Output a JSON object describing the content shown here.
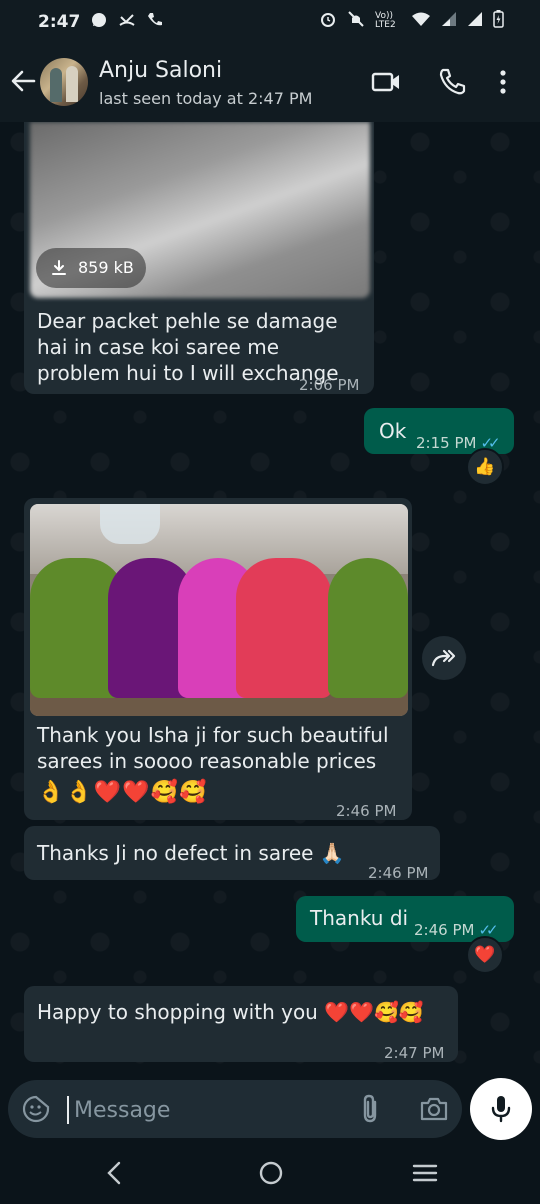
{
  "status_bar": {
    "time": "2:47",
    "left_icons": [
      "whatsapp-icon",
      "missed-call-icon",
      "call-icon"
    ],
    "right_icons": [
      "alarm-icon",
      "mute-icon",
      "volte-icon",
      "wifi-icon",
      "signal-icon",
      "signal-icon",
      "battery-icon"
    ],
    "network_label": "Vo)) LTE2"
  },
  "header": {
    "contact_name": "Anju Saloni",
    "last_seen": "last seen today at 2:47 PM"
  },
  "messages": [
    {
      "direction": "incoming",
      "attachment_size": "859 kB",
      "text": "Dear packet pehle se damage hai in case koi saree me problem hui to I will exchange",
      "time": "2:06 PM"
    },
    {
      "direction": "outgoing",
      "text": "Ok",
      "time": "2:15 PM",
      "reaction": "👍"
    },
    {
      "direction": "incoming",
      "text": "Thank you Isha ji for such beautiful sarees in soooo reasonable prices",
      "emojis": "👌👌❤️❤️🥰🥰",
      "time": "2:46 PM"
    },
    {
      "direction": "incoming",
      "text": "Thanks Ji no defect in saree 🙏🏻",
      "time": "2:46 PM"
    },
    {
      "direction": "outgoing",
      "text": "Thanku di",
      "time": "2:46 PM",
      "reaction": "❤️"
    },
    {
      "direction": "incoming",
      "text": "Happy to shopping with you ❤️❤️🥰🥰",
      "time": "2:47 PM"
    }
  ],
  "composer": {
    "placeholder": "Message"
  },
  "colors": {
    "background": "#0b141a",
    "incoming_bubble": "#202c33",
    "outgoing_bubble": "#005c4b",
    "read_ticks": "#53bdeb"
  }
}
